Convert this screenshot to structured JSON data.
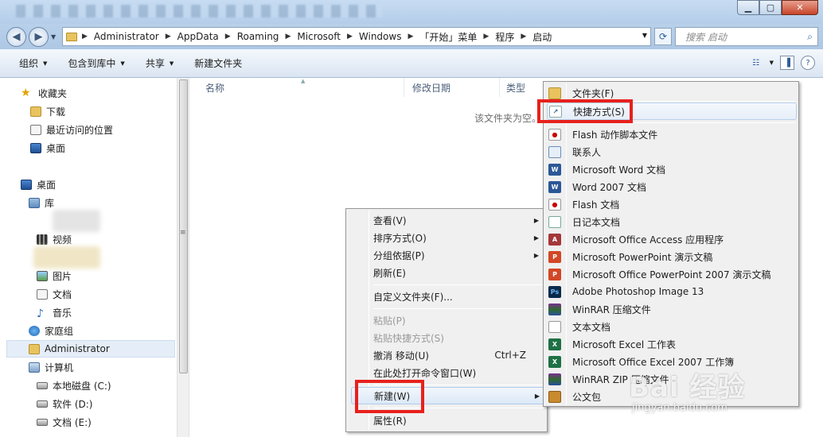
{
  "window": {
    "controls": [
      "minimize",
      "maximize",
      "close"
    ]
  },
  "address": {
    "crumbs": [
      "Administrator",
      "AppData",
      "Roaming",
      "Microsoft",
      "Windows",
      "「开始」菜单",
      "程序",
      "启动"
    ],
    "search_placeholder": "搜索 启动"
  },
  "toolbar": {
    "organize": "组织",
    "include_library": "包含到库中",
    "share": "共享",
    "new_folder": "新建文件夹"
  },
  "nav": {
    "favorites": "收藏夹",
    "downloads": "下载",
    "recent": "最近访问的位置",
    "desktop_fav": "桌面",
    "desktop": "桌面",
    "library": "库",
    "videos": "视频",
    "pictures": "图片",
    "documents": "文档",
    "music": "音乐",
    "homegroup": "家庭组",
    "user": "Administrator",
    "computer": "计算机",
    "drive_c": "本地磁盘 (C:)",
    "drive_d": "软件 (D:)",
    "drive_e": "文档 (E:)"
  },
  "columns": {
    "name": "名称",
    "modified": "修改日期",
    "type": "类型"
  },
  "empty_message": "该文件夹为空。",
  "context_menu": {
    "view": "查看(V)",
    "sort": "排序方式(O)",
    "group": "分组依据(P)",
    "refresh": "刷新(E)",
    "customize": "自定义文件夹(F)...",
    "paste": "粘贴(P)",
    "paste_shortcut": "粘贴快捷方式(S)",
    "undo": "撤消 移动(U)",
    "undo_shortcut": "Ctrl+Z",
    "cmd_here": "在此处打开命令窗口(W)",
    "new": "新建(W)",
    "properties": "属性(R)"
  },
  "new_submenu": {
    "folder": "文件夹(F)",
    "shortcut": "快捷方式(S)",
    "flash_action": "Flash 动作脚本文件",
    "contact": "联系人",
    "word": "Microsoft Word 文档",
    "word2007": "Word 2007 文档",
    "flash_doc": "Flash 文档",
    "journal": "日记本文档",
    "access": "Microsoft Office Access 应用程序",
    "ppt": "Microsoft PowerPoint 演示文稿",
    "ppt2007": "Microsoft Office PowerPoint 2007 演示文稿",
    "psd": "Adobe Photoshop Image 13",
    "rar": "WinRAR 压缩文件",
    "txt": "文本文档",
    "excel": "Microsoft Excel 工作表",
    "excel2007": "Microsoft Office Excel 2007 工作簿",
    "zip": "WinRAR ZIP 压缩文件",
    "briefcase": "公文包"
  },
  "watermark": {
    "logo": "Bai 经验",
    "url": "jingyan.baidu.com"
  }
}
